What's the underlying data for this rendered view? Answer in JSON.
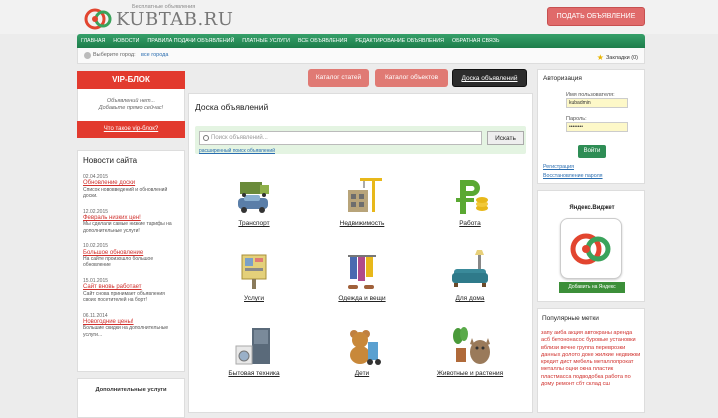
{
  "header": {
    "logo_text": "KUBTAB.RU",
    "logo_sub": "Бесплатные объявления",
    "post_button": "ПОДАТЬ ОБЪЯВЛЕНИЕ"
  },
  "nav": [
    "ГЛАВНАЯ",
    "НОВОСТИ",
    "ПРАВИЛА ПОДАЧИ ОБЪЯВЛЕНИЙ",
    "ПЛАТНЫЕ УСЛУГИ",
    "ВСЕ ОБЪЯВЛЕНИЯ",
    "РЕДАКТИРОВАНИЕ ОБЪЯВЛЕНИЯ",
    "ОБРАТНАЯ СВЯЗЬ"
  ],
  "citybar": {
    "label": "Выберите город:",
    "value": "все города",
    "bookmarks": "Закладки (0)"
  },
  "vip": {
    "title": "VIP-БЛОК",
    "empty1": "Объявлений нет...",
    "empty2": "Добавьте прямо сейчас!",
    "link": "Что такое vip-блок?"
  },
  "news": {
    "title": "Новости сайта",
    "items": [
      {
        "date": "02.04.2015",
        "title": "Обновление доски",
        "text": "Список нововведений и обновлений доски."
      },
      {
        "date": "12.02.2015",
        "title": "Февраль низких цен!",
        "text": "Мы сделали самые низкие тарифы на дополнительные услуги!"
      },
      {
        "date": "10.02.2015",
        "title": "Большое обновление",
        "text": "На сайте произошло большое обновление"
      },
      {
        "date": "15.01.2015",
        "title": "Сайт вновь работает",
        "text": "Сайт снова принимает объявления своих посетителей на борт!"
      },
      {
        "date": "06.11.2014",
        "title": "Новогодние цены!",
        "text": "Большие скидки на дополнительные услуги..."
      }
    ]
  },
  "extra": {
    "title": "Дополнительные услуги"
  },
  "tabs": [
    "Каталог статей",
    "Каталог объектов",
    "Доска объявлений"
  ],
  "main": {
    "title": "Доска объявлений",
    "search_placeholder": "Поиск объявлений...",
    "search_button": "Искать",
    "advanced": "расширенный поиск объявлений",
    "categories": [
      "Транспорт",
      "Недвижимость",
      "Работа",
      "Услуги",
      "Одежда и вещи",
      "Для дома",
      "Бытовая техника",
      "Дети",
      "Животные и растения"
    ]
  },
  "auth": {
    "title": "Авторизация",
    "user_label": "Имя пользователя:",
    "user_value": "kubadmin",
    "pass_label": "Пароль:",
    "pass_value": "••••••••",
    "login": "Войти",
    "register": "Регистрация",
    "restore": "Восстановление пароля"
  },
  "yandex": {
    "title": "Яндекс.Виджет",
    "add": "Добавить на Яндекс"
  },
  "tags": {
    "title": "Популярные метки",
    "text": "запу аиба акция автокраны аренда асб бетононасос буровые установки вблизи вечне группа переврозки данных долото доке жилкие недвижки кредит дист мебель металлопрокат металлы оцни окна пластик пластмасса подводобка работа по дому ремонт сбт склад сш",
    "color": "#d0312d"
  }
}
